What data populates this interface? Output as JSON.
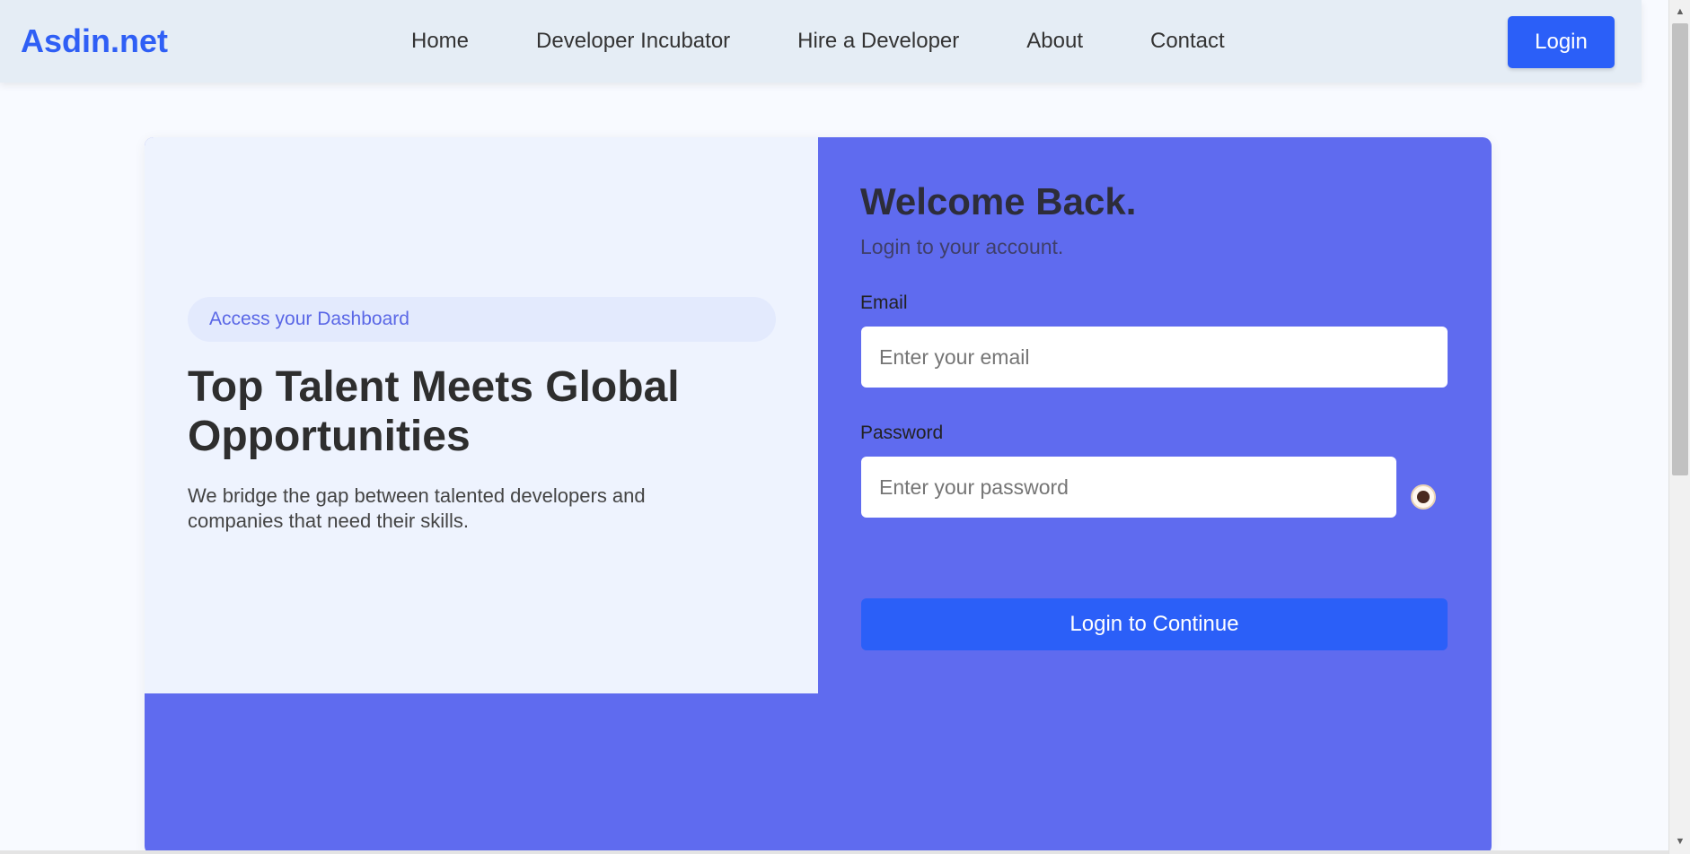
{
  "header": {
    "logo": "Asdin.net",
    "nav": [
      "Home",
      "Developer Incubator",
      "Hire a Developer",
      "About",
      "Contact"
    ],
    "login_label": "Login"
  },
  "hero": {
    "badge": "Access your Dashboard",
    "title": "Top Talent Meets Global Opportunities",
    "description": "We bridge the gap between talented developers and companies that need their skills."
  },
  "login_form": {
    "title": "Welcome Back.",
    "subtitle": "Login to your account.",
    "email_label": "Email",
    "email_placeholder": "Enter your email",
    "password_label": "Password",
    "password_placeholder": "Enter your password",
    "submit_label": "Login to Continue"
  },
  "colors": {
    "brand": "#2f5ff5",
    "accent_panel": "#5f6bef",
    "button": "#2b5ff8"
  },
  "icons": {
    "password_toggle": "eye-icon"
  }
}
